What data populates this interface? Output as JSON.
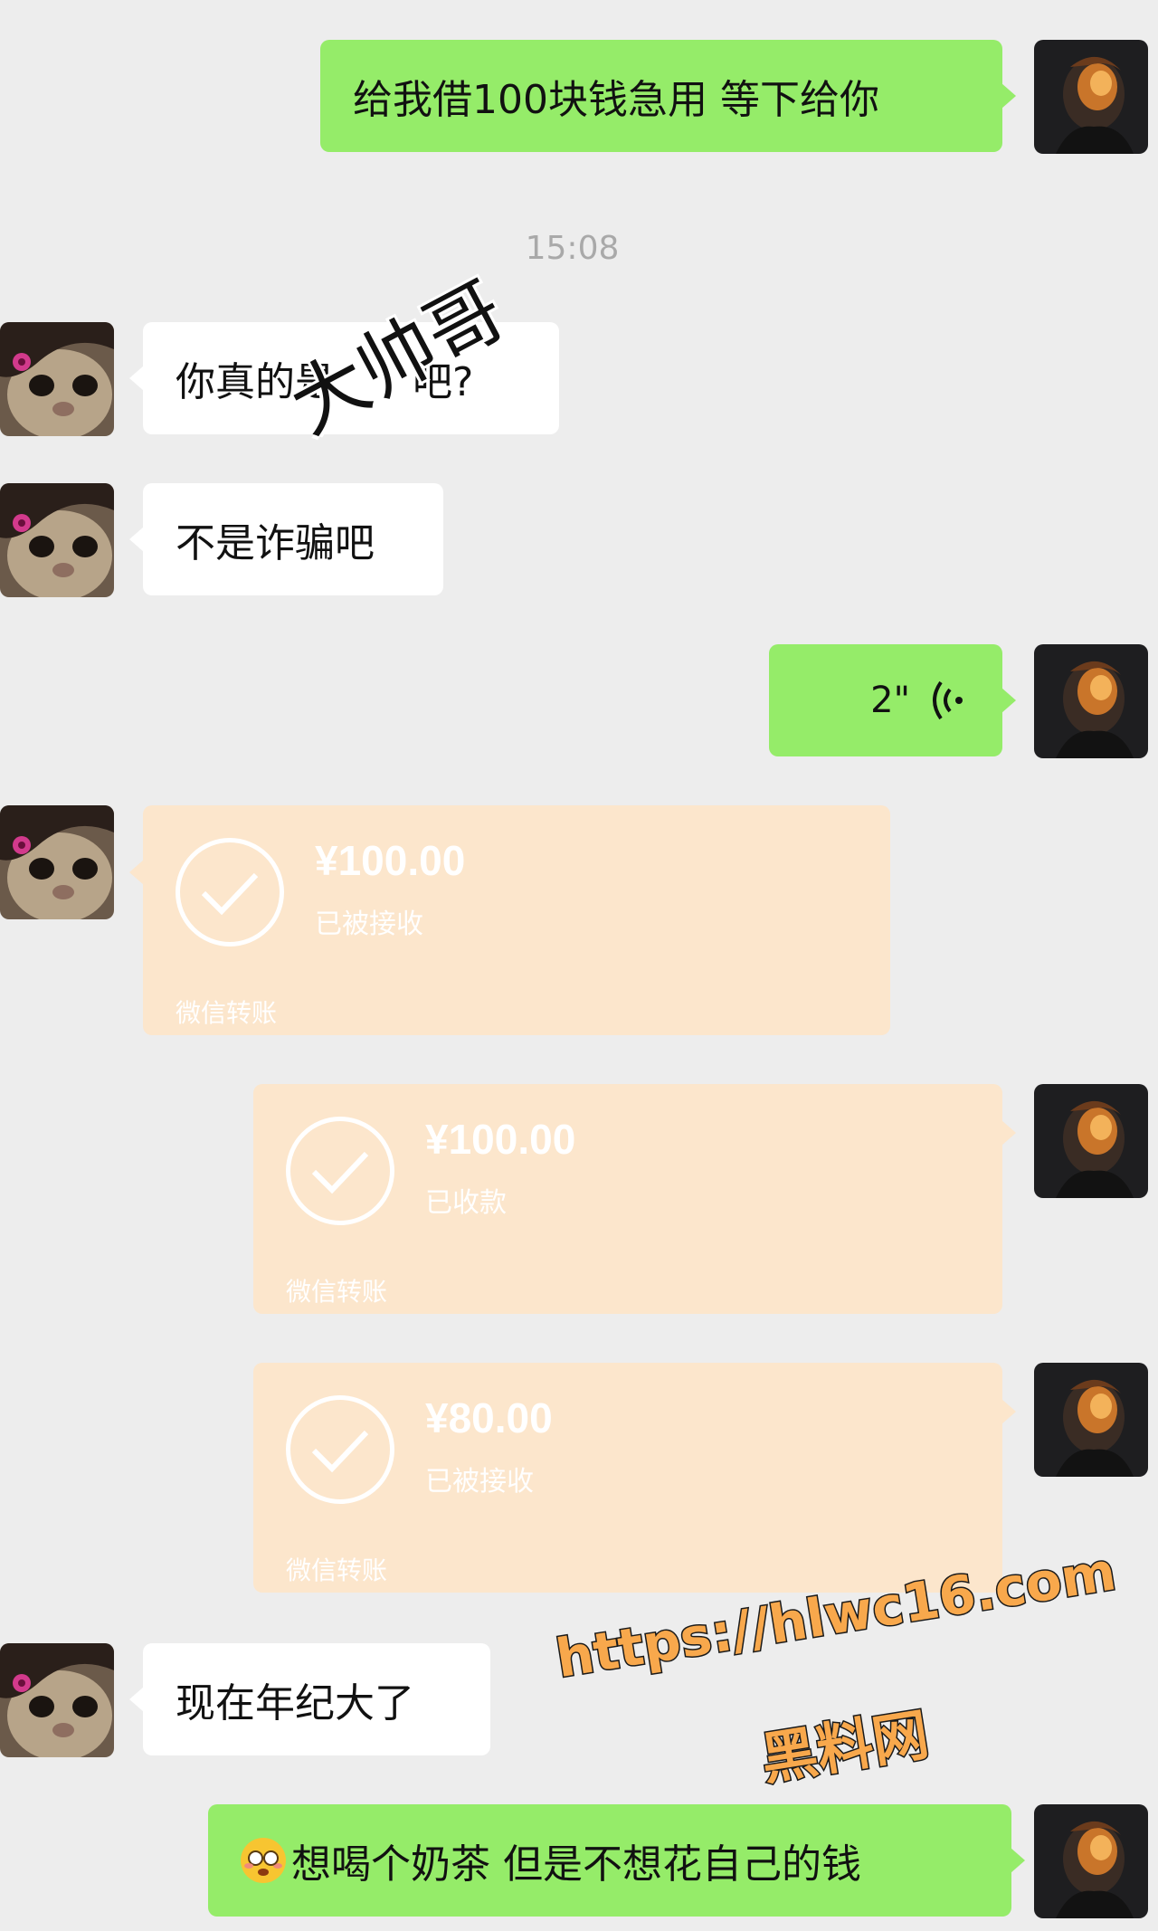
{
  "timestamp": "15:08",
  "messages": {
    "m1": "给我借100块钱急用 等下给你",
    "m2": "你真的是",
    "m2_tail": "吧?",
    "m3": "不是诈骗吧",
    "voice_length": "2\"",
    "m_last_left": "现在年纪大了",
    "m_last_right": "想喝个奶茶 但是不想花自己的钱"
  },
  "overlay_text": "大帅哥",
  "transfers": [
    {
      "amount": "¥100.00",
      "status": "已被接收",
      "footer": "微信转账"
    },
    {
      "amount": "¥100.00",
      "status": "已收款",
      "footer": "微信转账"
    },
    {
      "amount": "¥80.00",
      "status": "已被接收",
      "footer": "微信转账"
    }
  ],
  "watermark": {
    "url": "https://hlwc16.com",
    "name": "黑料网"
  },
  "icons": {
    "me_avatar": "dark-portrait-avatar",
    "friend_avatar": "cat-avatar",
    "voice": "voice-wave-icon",
    "check": "check-circle-icon",
    "emoji": "flushed-face-emoji"
  },
  "colors": {
    "background": "#ededed",
    "sent_bubble": "#95ec69",
    "received_bubble": "#ffffff",
    "transfer_card": "#fce6cc",
    "watermark": "#f8a84c"
  }
}
